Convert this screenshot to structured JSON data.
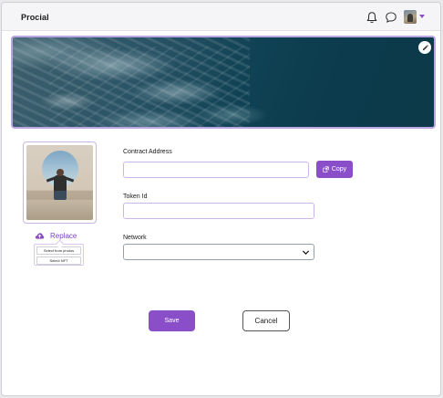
{
  "app": {
    "title": "Procial"
  },
  "header": {
    "icons": [
      "bell-icon",
      "chat-icon",
      "avatar",
      "chevron-down-icon"
    ]
  },
  "banner": {
    "edit_icon": "pencil-icon"
  },
  "profile": {
    "replace_label": "Replace",
    "replace_icon": "cloud-upload-icon",
    "menu": [
      "Select from photos",
      "Select NFT"
    ]
  },
  "form": {
    "contract_address": {
      "label": "Contract Address",
      "value": "",
      "placeholder": ""
    },
    "copy_label": "Copy",
    "copy_icon": "external-copy-icon",
    "token_id": {
      "label": "Token  Id",
      "value": "",
      "placeholder": ""
    },
    "network": {
      "label": "Network",
      "selected": ""
    }
  },
  "actions": {
    "save_label": "Save",
    "cancel_label": "Cancel"
  },
  "colors": {
    "accent": "#8a4fc8",
    "border_accent": "#c9b6ea"
  }
}
